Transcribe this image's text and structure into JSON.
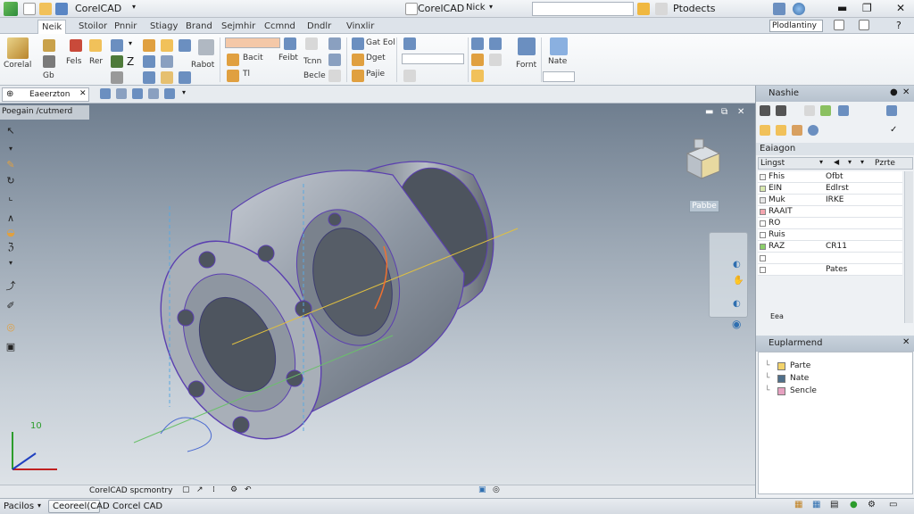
{
  "title_bar": {
    "app_label": "CorelCAD",
    "center_title": "CorelCAD",
    "center_sub": "Nick",
    "search_text": "Ptodects"
  },
  "tabs": [
    "Neik",
    "Stoilor",
    "Pnnir",
    "Stiagy",
    "Brand",
    "Sejmhir",
    "Ccmnd",
    "Dndlr",
    "Vinxlir"
  ],
  "ribbon": {
    "corel_label": "Corelal",
    "fels": "Fels",
    "gb": "Gb",
    "rer": "Rer",
    "rabot": "Rabot",
    "bacit": "Bacit",
    "tl": "Tl",
    "feibt": "Feibt",
    "tcnn": "Tcnn",
    "becle": "Becle",
    "got_eol": "Gat Eol",
    "dget": "Dget",
    "pajie": "Pajie",
    "fornt": "Fornt",
    "nate": "Nate",
    "right_label": "Plodlantiny"
  },
  "toolbar2": {
    "doc_tab": "Eaeerzton"
  },
  "viewport": {
    "label": "Poegain /cutmerd",
    "cube_label": "Pabbe",
    "axis_label": "10"
  },
  "right_panel": {
    "header": "Nashie",
    "section1": "Eaiagon",
    "col1": "Lingst",
    "col2": "Pzrte",
    "layers": [
      {
        "name": "Fhis",
        "value": "Ofbt",
        "color": "#f2f2f2"
      },
      {
        "name": "EIN",
        "value": "Edlrst",
        "color": "#d9e8b0"
      },
      {
        "name": "Muk",
        "value": "IRKE",
        "color": "#e8e8e8"
      },
      {
        "name": "RAAIT",
        "value": "",
        "color": "#f4a6b0"
      },
      {
        "name": "RO",
        "value": "",
        "color": "#ffffff"
      },
      {
        "name": "Ruis",
        "value": "",
        "color": "#ffffff"
      },
      {
        "name": "RAZ",
        "value": "CR11",
        "color": "#8ccf6a"
      },
      {
        "name": "",
        "value": "",
        "color": "#ffffff"
      },
      {
        "name": "",
        "value": "Pates",
        "color": "#ffffff"
      }
    ],
    "footer_small": "Eea",
    "section2": "Euplarmend",
    "tree": [
      {
        "label": "Parte",
        "color": "#f3d36b"
      },
      {
        "label": "Nate",
        "color": "#4f6f8a"
      },
      {
        "label": "Sencle",
        "color": "#e6a1c0"
      }
    ]
  },
  "status1": {
    "text": "CorelCAD spcmontry"
  },
  "status2": {
    "item1": "Pacilos",
    "item2": "Ceoreel(CAD",
    "item3": "Corcel CAD"
  },
  "colors": {
    "accent": "#2f6fb0",
    "model_fill": "#8a94a0",
    "outline": "#5b3fb0"
  }
}
